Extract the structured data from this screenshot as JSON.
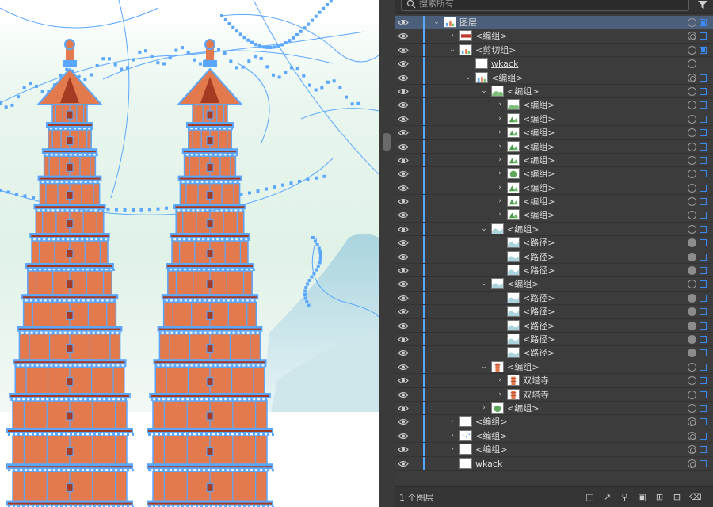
{
  "search": {
    "placeholder": "搜索所有"
  },
  "colors": {
    "selection": "#5aa7ff",
    "brick": "#e27a4e",
    "roof_dark": "#a63b24",
    "sky": "#e8f5ec"
  },
  "layers": [
    {
      "name": "图层",
      "depth": 0,
      "expand": "open",
      "thumb": "layer",
      "target": "single",
      "square": "on",
      "selected": true
    },
    {
      "name": "<编组>",
      "depth": 1,
      "expand": "closed",
      "thumb": "red",
      "target": "double",
      "square": "off"
    },
    {
      "name": "<剪切组>",
      "depth": 1,
      "expand": "open",
      "thumb": "layer",
      "target": "single",
      "square": "on"
    },
    {
      "name": "wkack",
      "depth": 2,
      "expand": "none",
      "thumb": "blank",
      "target": "single",
      "square": "none",
      "underline": true
    },
    {
      "name": "<编组>",
      "depth": 2,
      "expand": "open",
      "thumb": "layer",
      "target": "double",
      "square": "off"
    },
    {
      "name": "<编组>",
      "depth": 3,
      "expand": "open",
      "thumb": "hill",
      "target": "single",
      "square": "off"
    },
    {
      "name": "<编组>",
      "depth": 4,
      "expand": "closed",
      "thumb": "hill",
      "target": "single",
      "square": "off"
    },
    {
      "name": "<编组>",
      "depth": 4,
      "expand": "closed",
      "thumb": "tree",
      "target": "single",
      "square": "off"
    },
    {
      "name": "<编组>",
      "depth": 4,
      "expand": "closed",
      "thumb": "tree",
      "target": "single",
      "square": "off"
    },
    {
      "name": "<编组>",
      "depth": 4,
      "expand": "closed",
      "thumb": "tree",
      "target": "single",
      "square": "off"
    },
    {
      "name": "<编组>",
      "depth": 4,
      "expand": "closed",
      "thumb": "tree",
      "target": "single",
      "square": "off"
    },
    {
      "name": "<编组>",
      "depth": 4,
      "expand": "closed",
      "thumb": "bush",
      "target": "single",
      "square": "off"
    },
    {
      "name": "<编组>",
      "depth": 4,
      "expand": "closed",
      "thumb": "tree",
      "target": "single",
      "square": "off"
    },
    {
      "name": "<编组>",
      "depth": 4,
      "expand": "closed",
      "thumb": "tree",
      "target": "single",
      "square": "off"
    },
    {
      "name": "<编组>",
      "depth": 4,
      "expand": "closed",
      "thumb": "tree",
      "target": "single",
      "square": "off"
    },
    {
      "name": "<编组>",
      "depth": 3,
      "expand": "open",
      "thumb": "wave",
      "target": "single",
      "square": "off"
    },
    {
      "name": "<路径>",
      "depth": 4,
      "expand": "none",
      "thumb": "wave",
      "target": "filled",
      "square": "off"
    },
    {
      "name": "<路径>",
      "depth": 4,
      "expand": "none",
      "thumb": "wave",
      "target": "filled",
      "square": "off"
    },
    {
      "name": "<路径>",
      "depth": 4,
      "expand": "none",
      "thumb": "wave",
      "target": "filled",
      "square": "off"
    },
    {
      "name": "<编组>",
      "depth": 3,
      "expand": "open",
      "thumb": "wave",
      "target": "single",
      "square": "off"
    },
    {
      "name": "<路径>",
      "depth": 4,
      "expand": "none",
      "thumb": "wave",
      "target": "filled",
      "square": "off"
    },
    {
      "name": "<路径>",
      "depth": 4,
      "expand": "none",
      "thumb": "wave",
      "target": "filled",
      "square": "off"
    },
    {
      "name": "<路径>",
      "depth": 4,
      "expand": "none",
      "thumb": "wave",
      "target": "filled",
      "square": "off"
    },
    {
      "name": "<路径>",
      "depth": 4,
      "expand": "none",
      "thumb": "wave",
      "target": "filled",
      "square": "off"
    },
    {
      "name": "<路径>",
      "depth": 4,
      "expand": "none",
      "thumb": "wave",
      "target": "filled",
      "square": "off"
    },
    {
      "name": "<编组>",
      "depth": 3,
      "expand": "open",
      "thumb": "pagoda",
      "target": "single",
      "square": "off"
    },
    {
      "name": "双塔寺",
      "depth": 4,
      "expand": "closed",
      "thumb": "pagoda",
      "target": "single",
      "square": "off"
    },
    {
      "name": "双塔寺",
      "depth": 4,
      "expand": "closed",
      "thumb": "pagoda",
      "target": "single",
      "square": "off"
    },
    {
      "name": "<编组>",
      "depth": 3,
      "expand": "closed",
      "thumb": "bush",
      "target": "single",
      "square": "off"
    },
    {
      "name": "<编组>",
      "depth": 1,
      "expand": "closed",
      "thumb": "blank",
      "target": "double",
      "square": "off"
    },
    {
      "name": "<编组>",
      "depth": 1,
      "expand": "closed",
      "thumb": "dots",
      "target": "double",
      "square": "off"
    },
    {
      "name": "<编组>",
      "depth": 1,
      "expand": "closed",
      "thumb": "blank",
      "target": "double",
      "square": "off"
    },
    {
      "name": "wkack",
      "depth": 1,
      "expand": "none",
      "thumb": "blank",
      "target": "double",
      "square": "off"
    }
  ],
  "footer": {
    "count": "1 个图层",
    "buttons": [
      "collect-export",
      "export",
      "locate-object",
      "make-clipping-mask",
      "new-sublayer",
      "new-layer",
      "delete"
    ]
  }
}
